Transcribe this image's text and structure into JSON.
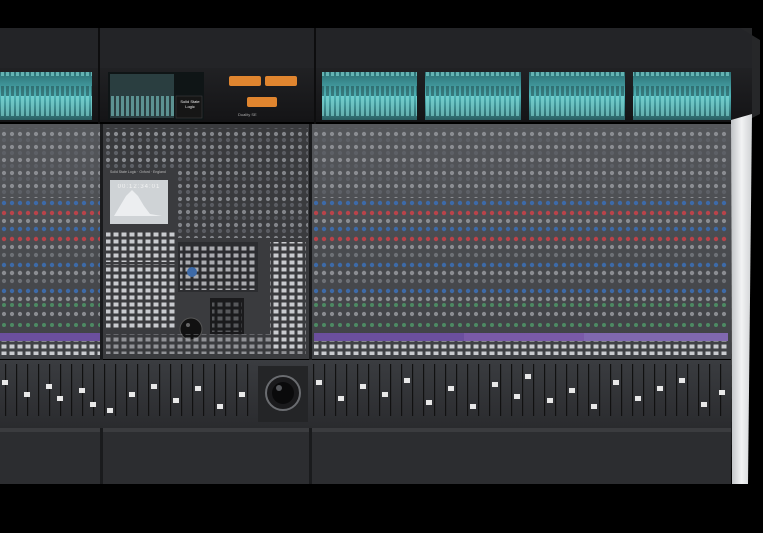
{
  "scene": {
    "subject": "",
    "brand_text": "Solid State Logic",
    "model_text": "Duality SE",
    "center_label": "Solid State Logic · Oxford · England",
    "lcd_readout": "00:12:34:01"
  },
  "palette": {
    "background": "#000000",
    "panel_dark": "#1c1c1e",
    "panel_mid": "#3a3b3e",
    "strip_face": "#4a4c50",
    "screen_teal": "#56c0c4",
    "orange_button": "#e0852f",
    "side_silver": "#e4e6e8",
    "knob_blue": "#3d6aa8",
    "knob_red": "#b9434a",
    "knob_grey": "#8b8d92",
    "label_purple": "#6b4f9e"
  },
  "layout_groups": {
    "left_bay_strips": 12,
    "right_bay_strips": 32,
    "meter_screens": 5
  }
}
